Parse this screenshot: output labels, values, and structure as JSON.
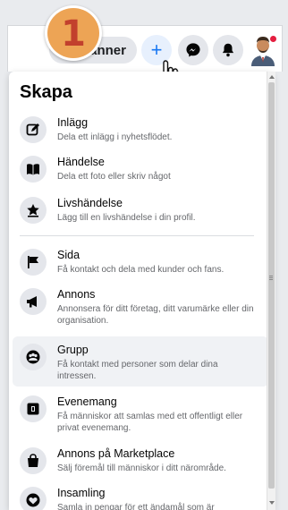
{
  "header": {
    "friends_label": "vänner",
    "step_badge": "1",
    "plus_glyph": "+",
    "icons": [
      "plus-icon",
      "messenger-icon",
      "bell-icon",
      "avatar"
    ]
  },
  "panel": {
    "title": "Skapa",
    "items": [
      {
        "title": "Inlägg",
        "desc": "Dela ett inlägg i nyhetsflödet.",
        "icon": "compose-icon"
      },
      {
        "title": "Händelse",
        "desc": "Dela ett foto eller skriv något",
        "icon": "book-icon"
      },
      {
        "title": "Livshändelse",
        "desc": "Lägg till en livshändelse i din profil.",
        "icon": "star-icon"
      },
      {
        "title": "Sida",
        "desc": "Få kontakt och dela med kunder och fans.",
        "icon": "flag-icon"
      },
      {
        "title": "Annons",
        "desc": "Annonsera för ditt företag, ditt varumärke eller din organisation.",
        "icon": "megaphone-icon"
      },
      {
        "title": "Grupp",
        "desc": "Få kontakt med personer som delar dina intressen.",
        "icon": "group-icon"
      },
      {
        "title": "Evenemang",
        "desc": "Få människor att samlas med ett offentligt eller privat evenemang.",
        "icon": "calendar-icon"
      },
      {
        "title": "Annons på Marketplace",
        "desc": "Sälj föremål till människor i ditt närområde.",
        "icon": "bag-icon"
      },
      {
        "title": "Insamling",
        "desc": "Samla in pengar för ett ändamål som är",
        "icon": "heart-icon"
      }
    ]
  },
  "colors": {
    "accent": "#1877f2",
    "badge": "#eda455",
    "badge_text": "#c2402d",
    "highlight": "#f0f2f5"
  }
}
